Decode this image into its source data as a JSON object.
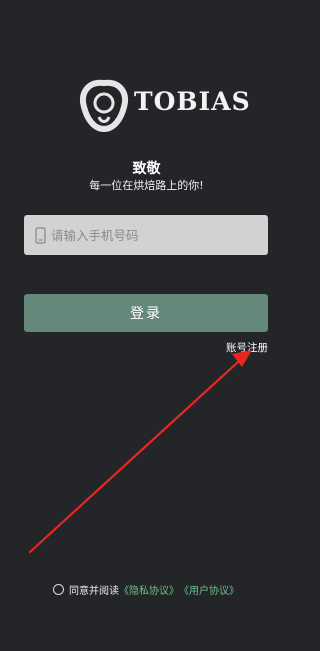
{
  "brand": {
    "name": "TOBIAS"
  },
  "greeting": {
    "title": "致敬",
    "subtitle": "每一位在烘焙路上的你!"
  },
  "phone_field": {
    "placeholder": "请输入手机号码",
    "value": "",
    "icon": "mobile-phone-icon"
  },
  "login_button": {
    "label": "登录"
  },
  "register_link": {
    "label": "账号注册"
  },
  "agreement": {
    "checked": false,
    "text": "同意并阅读",
    "privacy_label": "《隐私协议》",
    "user_label": "《用户协议》"
  },
  "colors": {
    "background": "#232529",
    "accent_green": "#64887a",
    "link_green": "#6cc087",
    "annotation_red": "#e8281e",
    "input_bg": "#d2d2d2"
  }
}
